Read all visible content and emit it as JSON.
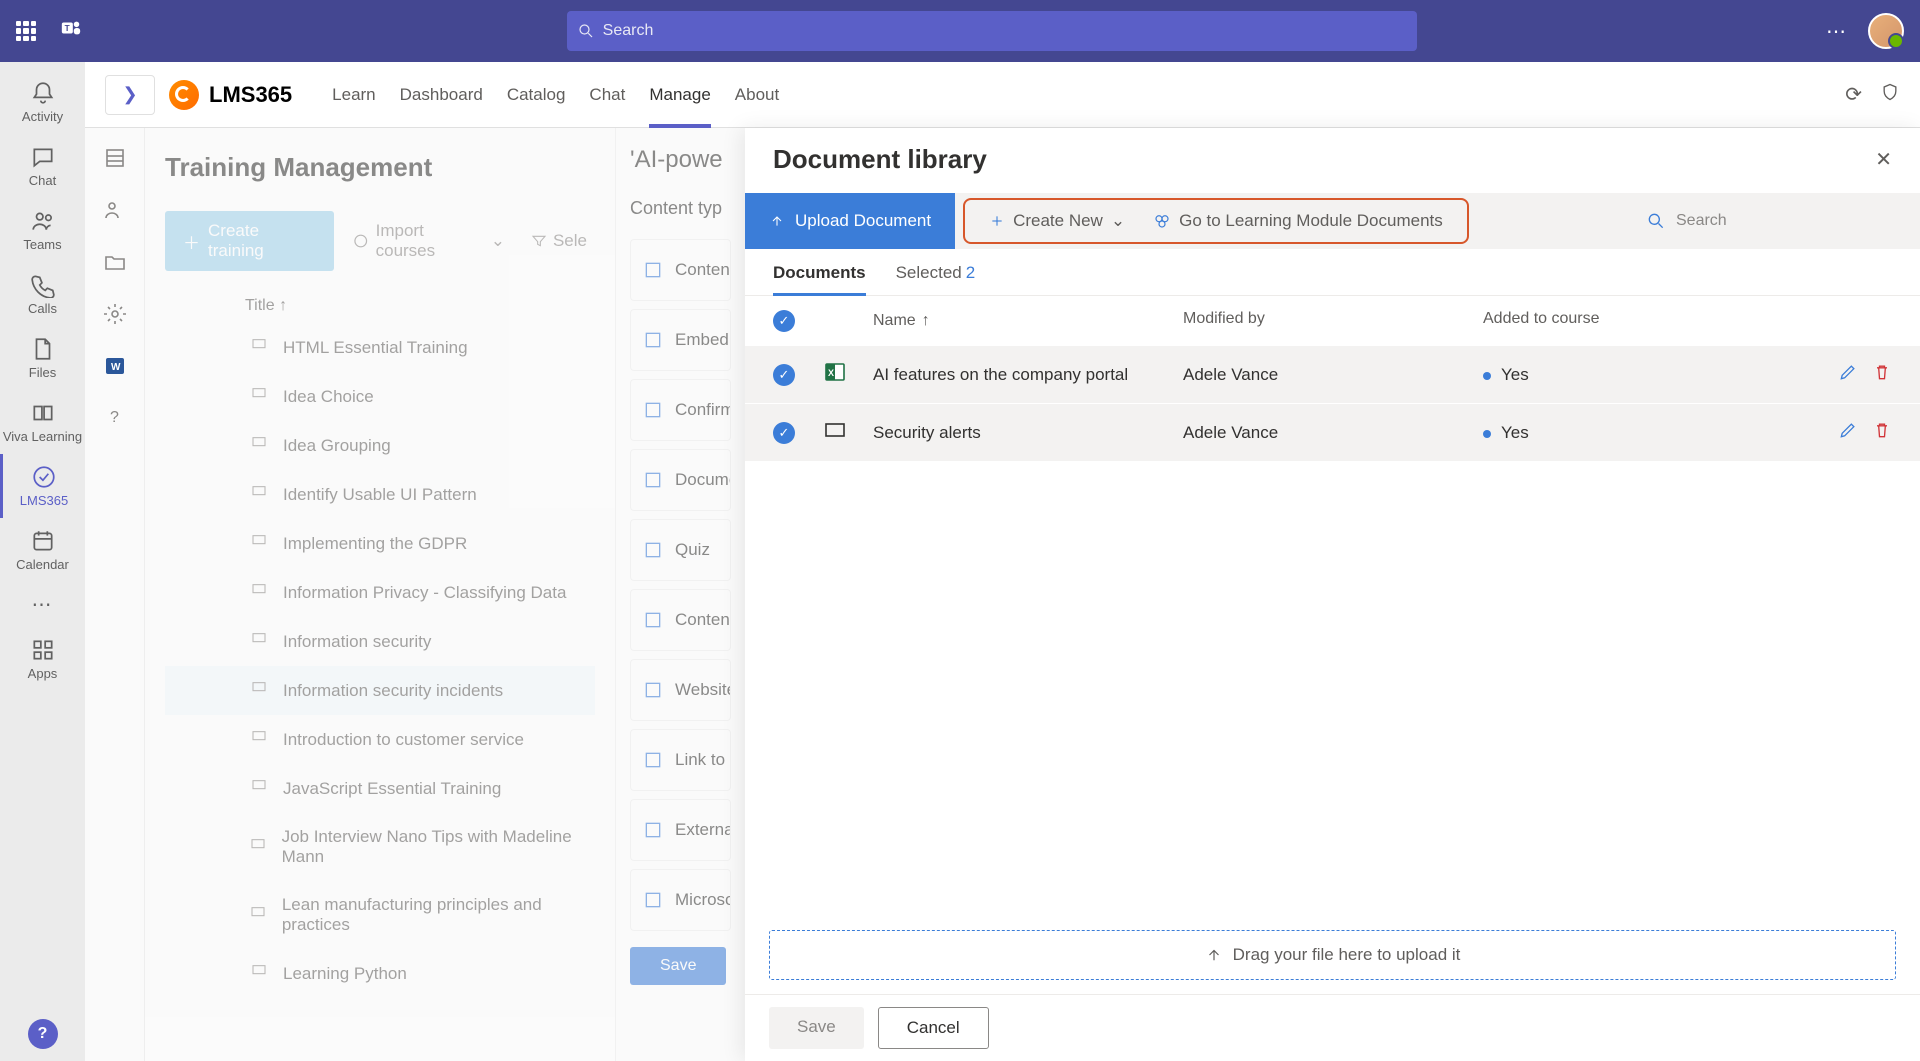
{
  "teams_topbar": {
    "search_placeholder": "Search"
  },
  "left_rail": {
    "items": [
      {
        "label": "Activity"
      },
      {
        "label": "Chat"
      },
      {
        "label": "Teams"
      },
      {
        "label": "Calls"
      },
      {
        "label": "Files"
      },
      {
        "label": "Viva Learning"
      },
      {
        "label": "LMS365"
      },
      {
        "label": "Calendar"
      },
      {
        "label": "Apps"
      }
    ]
  },
  "app_tabbar": {
    "app_name": "LMS365",
    "tabs": [
      {
        "label": "Learn"
      },
      {
        "label": "Dashboard"
      },
      {
        "label": "Catalog"
      },
      {
        "label": "Chat"
      },
      {
        "label": "Manage"
      },
      {
        "label": "About"
      }
    ]
  },
  "training_panel": {
    "title": "Training Management",
    "btn_create": "Create training",
    "btn_import": "Import courses",
    "btn_filter": "Sele",
    "list_header": "Title",
    "courses": [
      {
        "title": "HTML Essential Training"
      },
      {
        "title": "Idea Choice"
      },
      {
        "title": "Idea Grouping"
      },
      {
        "title": "Identify Usable UI Pattern"
      },
      {
        "title": "Implementing the GDPR"
      },
      {
        "title": "Information Privacy - Classifying Data"
      },
      {
        "title": "Information security"
      },
      {
        "title": "Information security incidents",
        "selected": true
      },
      {
        "title": "Introduction to customer service"
      },
      {
        "title": "JavaScript Essential Training"
      },
      {
        "title": "Job Interview Nano Tips with Madeline Mann"
      },
      {
        "title": "Lean manufacturing principles and practices"
      },
      {
        "title": "Learning Python"
      }
    ]
  },
  "contenttype": {
    "title_peek": "'AI-powe",
    "subtitle": "Content typ",
    "rows": [
      "Content",
      "Embed",
      "Confirm",
      "Docume",
      "Quiz",
      "Content",
      "Website",
      "Link to",
      "Externa",
      "Microso"
    ],
    "save": "Save"
  },
  "doclib": {
    "title": "Document library",
    "cmd_upload": "Upload Document",
    "cmd_create": "Create New",
    "cmd_goto": "Go to Learning Module Documents",
    "search_placeholder": "Search",
    "tabs": {
      "documents": "Documents",
      "selected": "Selected",
      "selected_count": "2"
    },
    "headers": {
      "name": "Name",
      "modified_by": "Modified by",
      "added": "Added to course"
    },
    "rows": [
      {
        "name": "AI features on the company portal",
        "modified_by": "Adele Vance",
        "added": "Yes",
        "icon": "excel"
      },
      {
        "name": "Security alerts",
        "modified_by": "Adele Vance",
        "added": "Yes",
        "icon": "video"
      }
    ],
    "dropzone": "Drag your file here to upload it",
    "btn_save": "Save",
    "btn_cancel": "Cancel"
  }
}
